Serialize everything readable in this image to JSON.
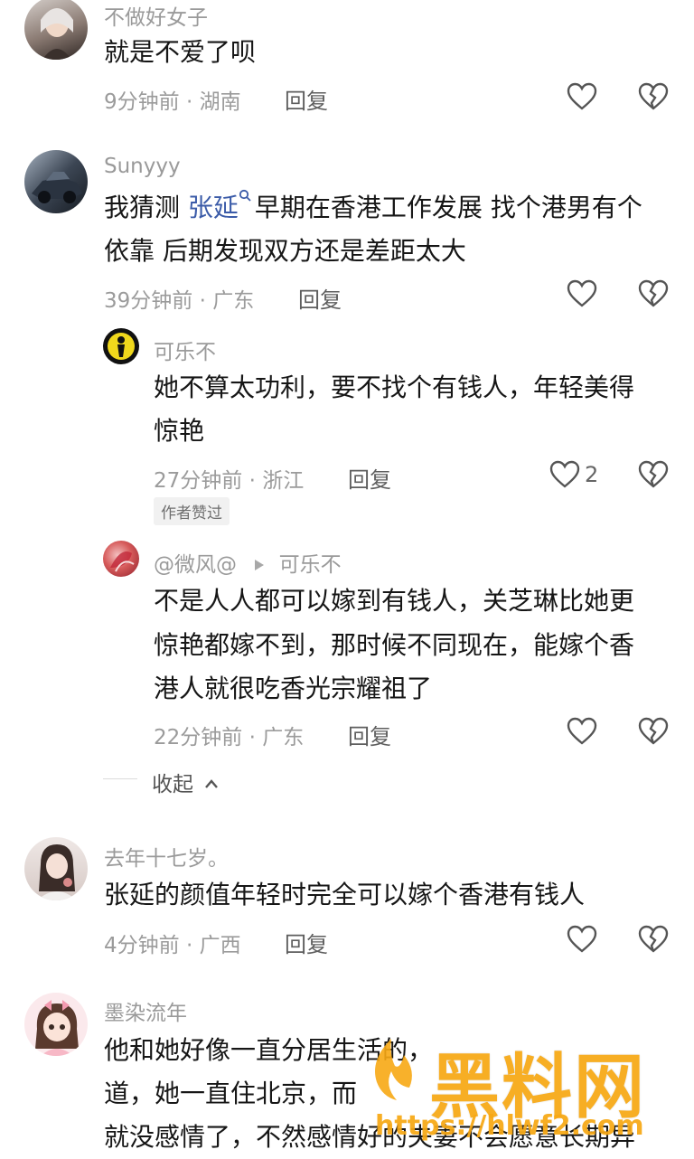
{
  "comments": [
    {
      "username": "不做好女子",
      "text_lines": [
        "就是不爱了呗"
      ],
      "meta": "9分钟前 · 湖南",
      "reply_label": "回复"
    },
    {
      "username": "Sunyyy",
      "text_prefix": "我猜测 ",
      "mention": "张延",
      "text_suffix": "早期在香港工作发展 找个港男有个",
      "text_line2": "依靠  后期发现双方还是差距太大",
      "meta": "39分钟前 · 广东",
      "reply_label": "回复",
      "replies": [
        {
          "username": "可乐不",
          "text_lines": [
            "她不算太功利，要不找个有钱人，年轻美得",
            "惊艳"
          ],
          "meta": "27分钟前 · 浙江",
          "reply_label": "回复",
          "like_count": "2",
          "badge": "作者赞过"
        },
        {
          "username": "@微风@",
          "reply_to": "可乐不",
          "text_lines": [
            "不是人人都可以嫁到有钱人，关芝琳比她更",
            "惊艳都嫁不到，那时候不同现在，能嫁个香",
            "港人就很吃香光宗耀祖了"
          ],
          "meta": "22分钟前 · 广东",
          "reply_label": "回复"
        }
      ],
      "collapse_label": "收起"
    },
    {
      "username": "去年十七岁。",
      "text_lines": [
        "张延的颜值年轻时完全可以嫁个香港有钱人"
      ],
      "meta": "4分钟前 · 广西",
      "reply_label": "回复"
    },
    {
      "username": "墨染流年",
      "text_lines": [
        "他和她好像一直分居生活的，",
        "道，她一直住北京，而",
        "就没感情了，不然感情好的夫妻不会愿意长期异"
      ]
    }
  ],
  "watermark": {
    "title": "黑料网",
    "url": "https://hlwf2.com"
  },
  "colors": {
    "mention": "#3b5ba8",
    "watermark": "#f7a814"
  }
}
